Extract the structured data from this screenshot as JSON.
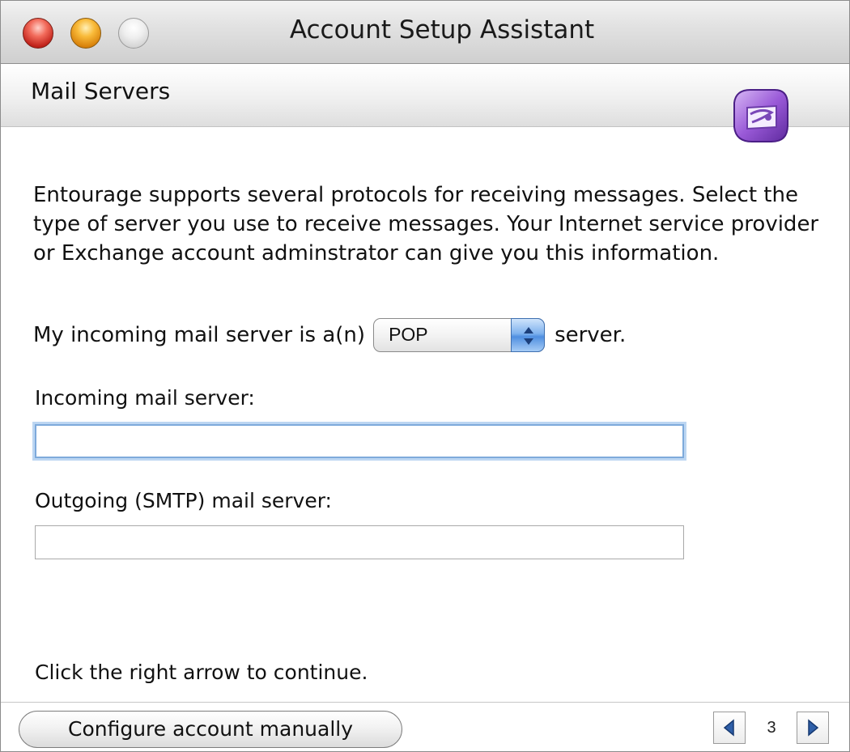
{
  "window": {
    "title": "Account Setup Assistant"
  },
  "header": {
    "heading": "Mail Servers",
    "logo_icon": "entourage-logo-icon"
  },
  "main": {
    "description": "Entourage supports several protocols for receiving messages. Select the type of server you use to receive messages. Your Internet service provider or Exchange account adminstrator can give you this information.",
    "server_type": {
      "prefix": "My incoming mail server is a(n)",
      "selected": "POP",
      "suffix": "server."
    },
    "incoming": {
      "label": "Incoming mail server:",
      "value": ""
    },
    "outgoing": {
      "label": "Outgoing (SMTP) mail server:",
      "value": ""
    },
    "hint": "Click the right arrow to continue."
  },
  "footer": {
    "manual_button": "Configure account manually",
    "page_number": "3"
  },
  "colors": {
    "focus_ring": "#7eaadb",
    "logo_purple": "#8a4fc8",
    "nav_arrow": "#2f5fa8"
  }
}
